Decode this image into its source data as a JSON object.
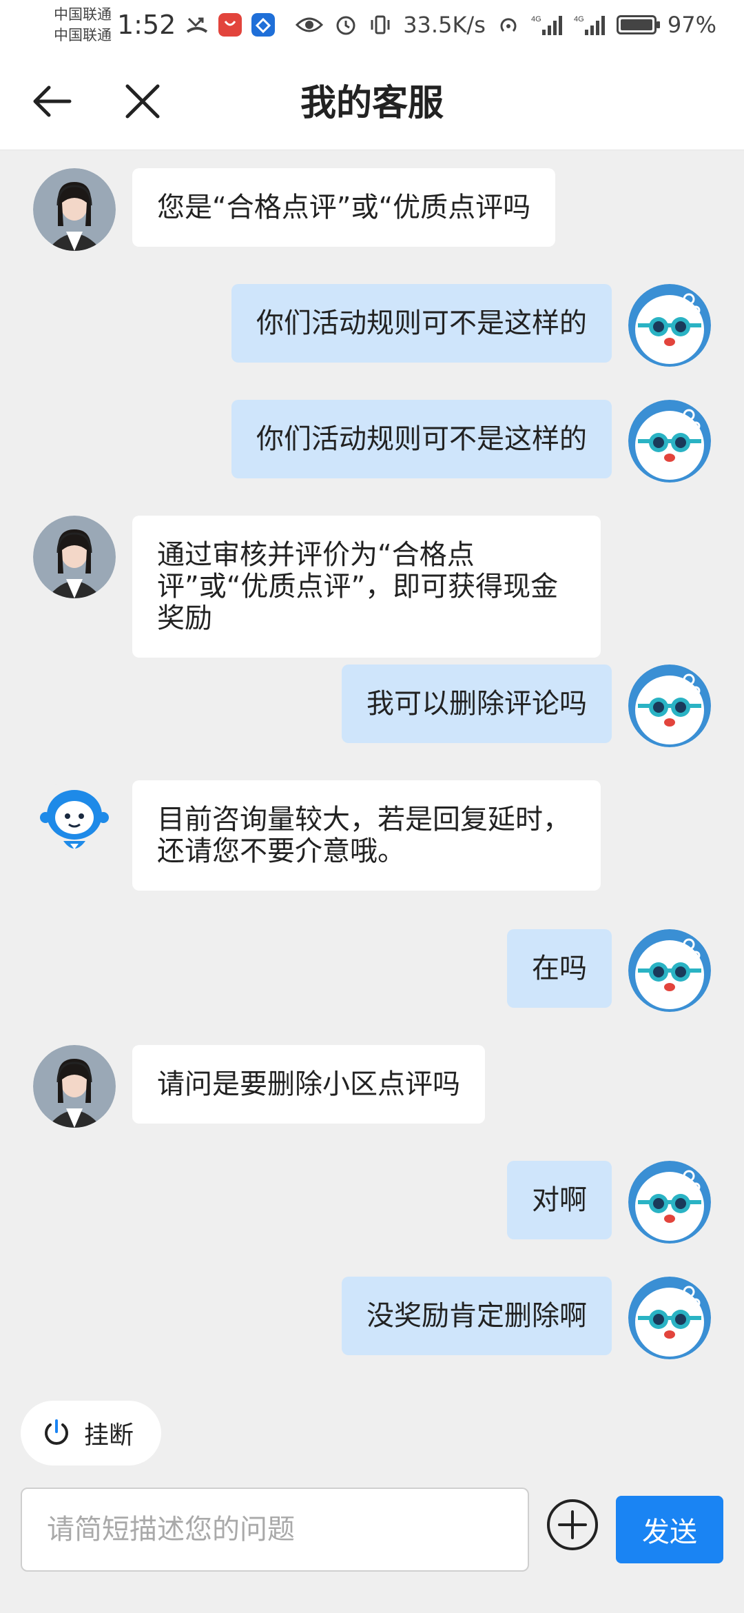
{
  "status_bar": {
    "carrier_1": "中国联通",
    "carrier_2": "中国联通",
    "time": "1:52",
    "net_speed": "33.5K/s",
    "battery": "97%",
    "battery_level": 0.97
  },
  "header": {
    "title": "我的客服",
    "back_icon": "arrow-left-icon",
    "close_icon": "close-icon"
  },
  "messages": [
    {
      "side": "left",
      "avatar": "agent-photo",
      "text": "您是“合格点评”或“优质点评吗"
    },
    {
      "side": "right",
      "avatar": "user-mascot",
      "text": "你们活动规则可不是这样的"
    },
    {
      "side": "right",
      "avatar": "user-mascot",
      "text": "你们活动规则可不是这样的"
    },
    {
      "side": "left",
      "avatar": "agent-photo",
      "text": "通过审核并评价为“合格点评”或“优质点评”，即可获得现金奖励"
    },
    {
      "side": "right",
      "avatar": "user-mascot",
      "text": "我可以删除评论吗"
    },
    {
      "side": "left",
      "avatar": "robot",
      "text": "目前咨询量较大，若是回复延时，还请您不要介意哦。"
    },
    {
      "side": "right",
      "avatar": "user-mascot",
      "text": "在吗"
    },
    {
      "side": "left",
      "avatar": "agent-photo",
      "text": "请问是要删除小区点评吗"
    },
    {
      "side": "right",
      "avatar": "user-mascot",
      "text": "对啊"
    },
    {
      "side": "right",
      "avatar": "user-mascot",
      "text": "没奖励肯定删除啊"
    }
  ],
  "bottom": {
    "hangup_label": "挂断",
    "input_placeholder": "请简短描述您的问题",
    "send_label": "发送"
  },
  "colors": {
    "accent": "#1a84f3",
    "user_bubble": "#cfe5fb",
    "agent_bubble": "#ffffff",
    "background": "#efefef"
  }
}
